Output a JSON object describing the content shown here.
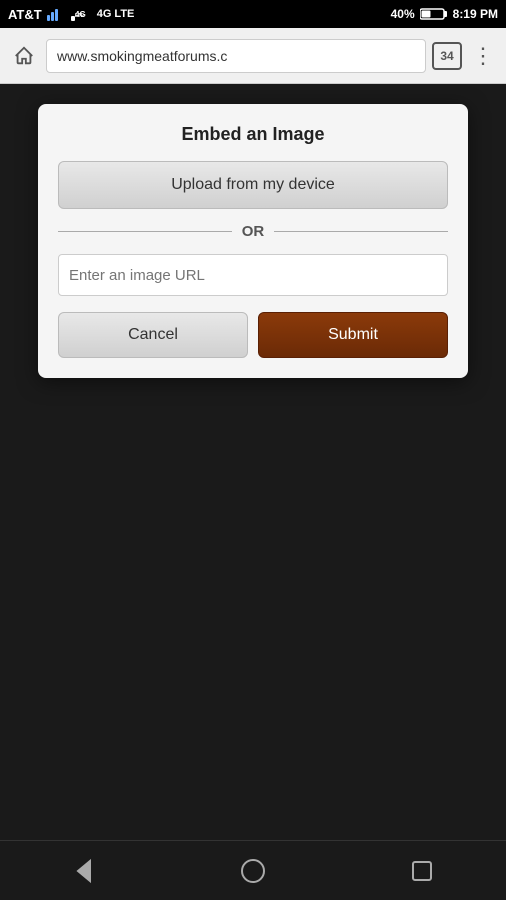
{
  "statusBar": {
    "carrier": "AT&T",
    "network": "4G",
    "signal": "▂▄▆",
    "battery": "40%",
    "time": "8:19 PM"
  },
  "browserBar": {
    "url": "www.smokingmeatforums.c",
    "tabCount": "34"
  },
  "dialog": {
    "title": "Embed an Image",
    "uploadBtn": "Upload from my device",
    "orText": "OR",
    "urlPlaceholder": "Enter an image URL",
    "cancelBtn": "Cancel",
    "submitBtn": "Submit"
  }
}
